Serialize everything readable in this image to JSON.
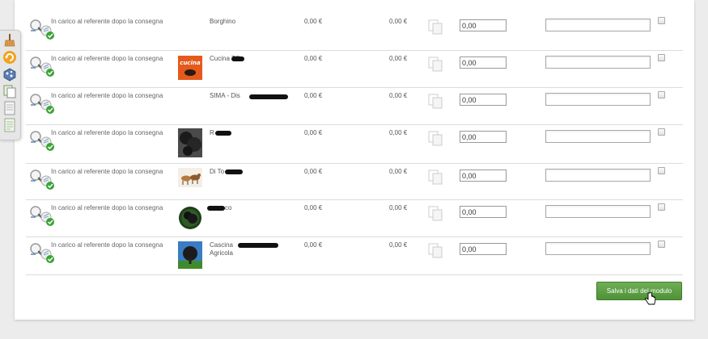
{
  "table": {
    "rows": [
      {
        "status": "In carico al referente dopo la consegna",
        "name": "Borghino",
        "price1": "0,00 €",
        "price2": "0,00 €",
        "quantity": "0,00",
        "logo": "none"
      },
      {
        "status": "In carico al referente dopo la consegna",
        "name": "Cucina TO",
        "price1": "0,00 €",
        "price2": "0,00 €",
        "quantity": "0,00",
        "logo": "cucina-logo"
      },
      {
        "status": "In carico al referente dopo la consegna",
        "name": "SIMA - Dis",
        "price1": "0,00 €",
        "price2": "0,00 €",
        "quantity": "0,00",
        "logo": "none"
      },
      {
        "status": "In carico al referente dopo la consegna",
        "name": "R",
        "price1": "0,00 €",
        "price2": "0,00 €",
        "quantity": "0,00",
        "logo": "dark-photo"
      },
      {
        "status": "In carico al referente dopo la consegna",
        "name": "Di To",
        "price1": "0,00 €",
        "price2": "0,00 €",
        "quantity": "0,00",
        "logo": "animals-photo"
      },
      {
        "status": "In carico al referente dopo la consegna",
        "name": "co",
        "price1": "0,00 €",
        "price2": "0,00 €",
        "quantity": "0,00",
        "logo": "round-tree-logo"
      },
      {
        "status": "In carico al referente dopo la consegna",
        "name": "Cascina Agricola",
        "price1": "0,00 €",
        "price2": "0,00 €",
        "quantity": "0,00",
        "logo": "tree-logo"
      }
    ]
  },
  "form": {
    "save_label": "Salva i dati del modulo"
  },
  "colors": {
    "save_button": "#5a9e3f",
    "check_badge": "#3aa335",
    "cucina_orange": "#e55a1c"
  },
  "icons": [
    "magnifier-icon",
    "note-check-icon",
    "copy-icon",
    "checkbox",
    "hand-cursor-icon",
    "broom-icon",
    "refresh-icon",
    "puzzle-icon",
    "document-icon"
  ]
}
